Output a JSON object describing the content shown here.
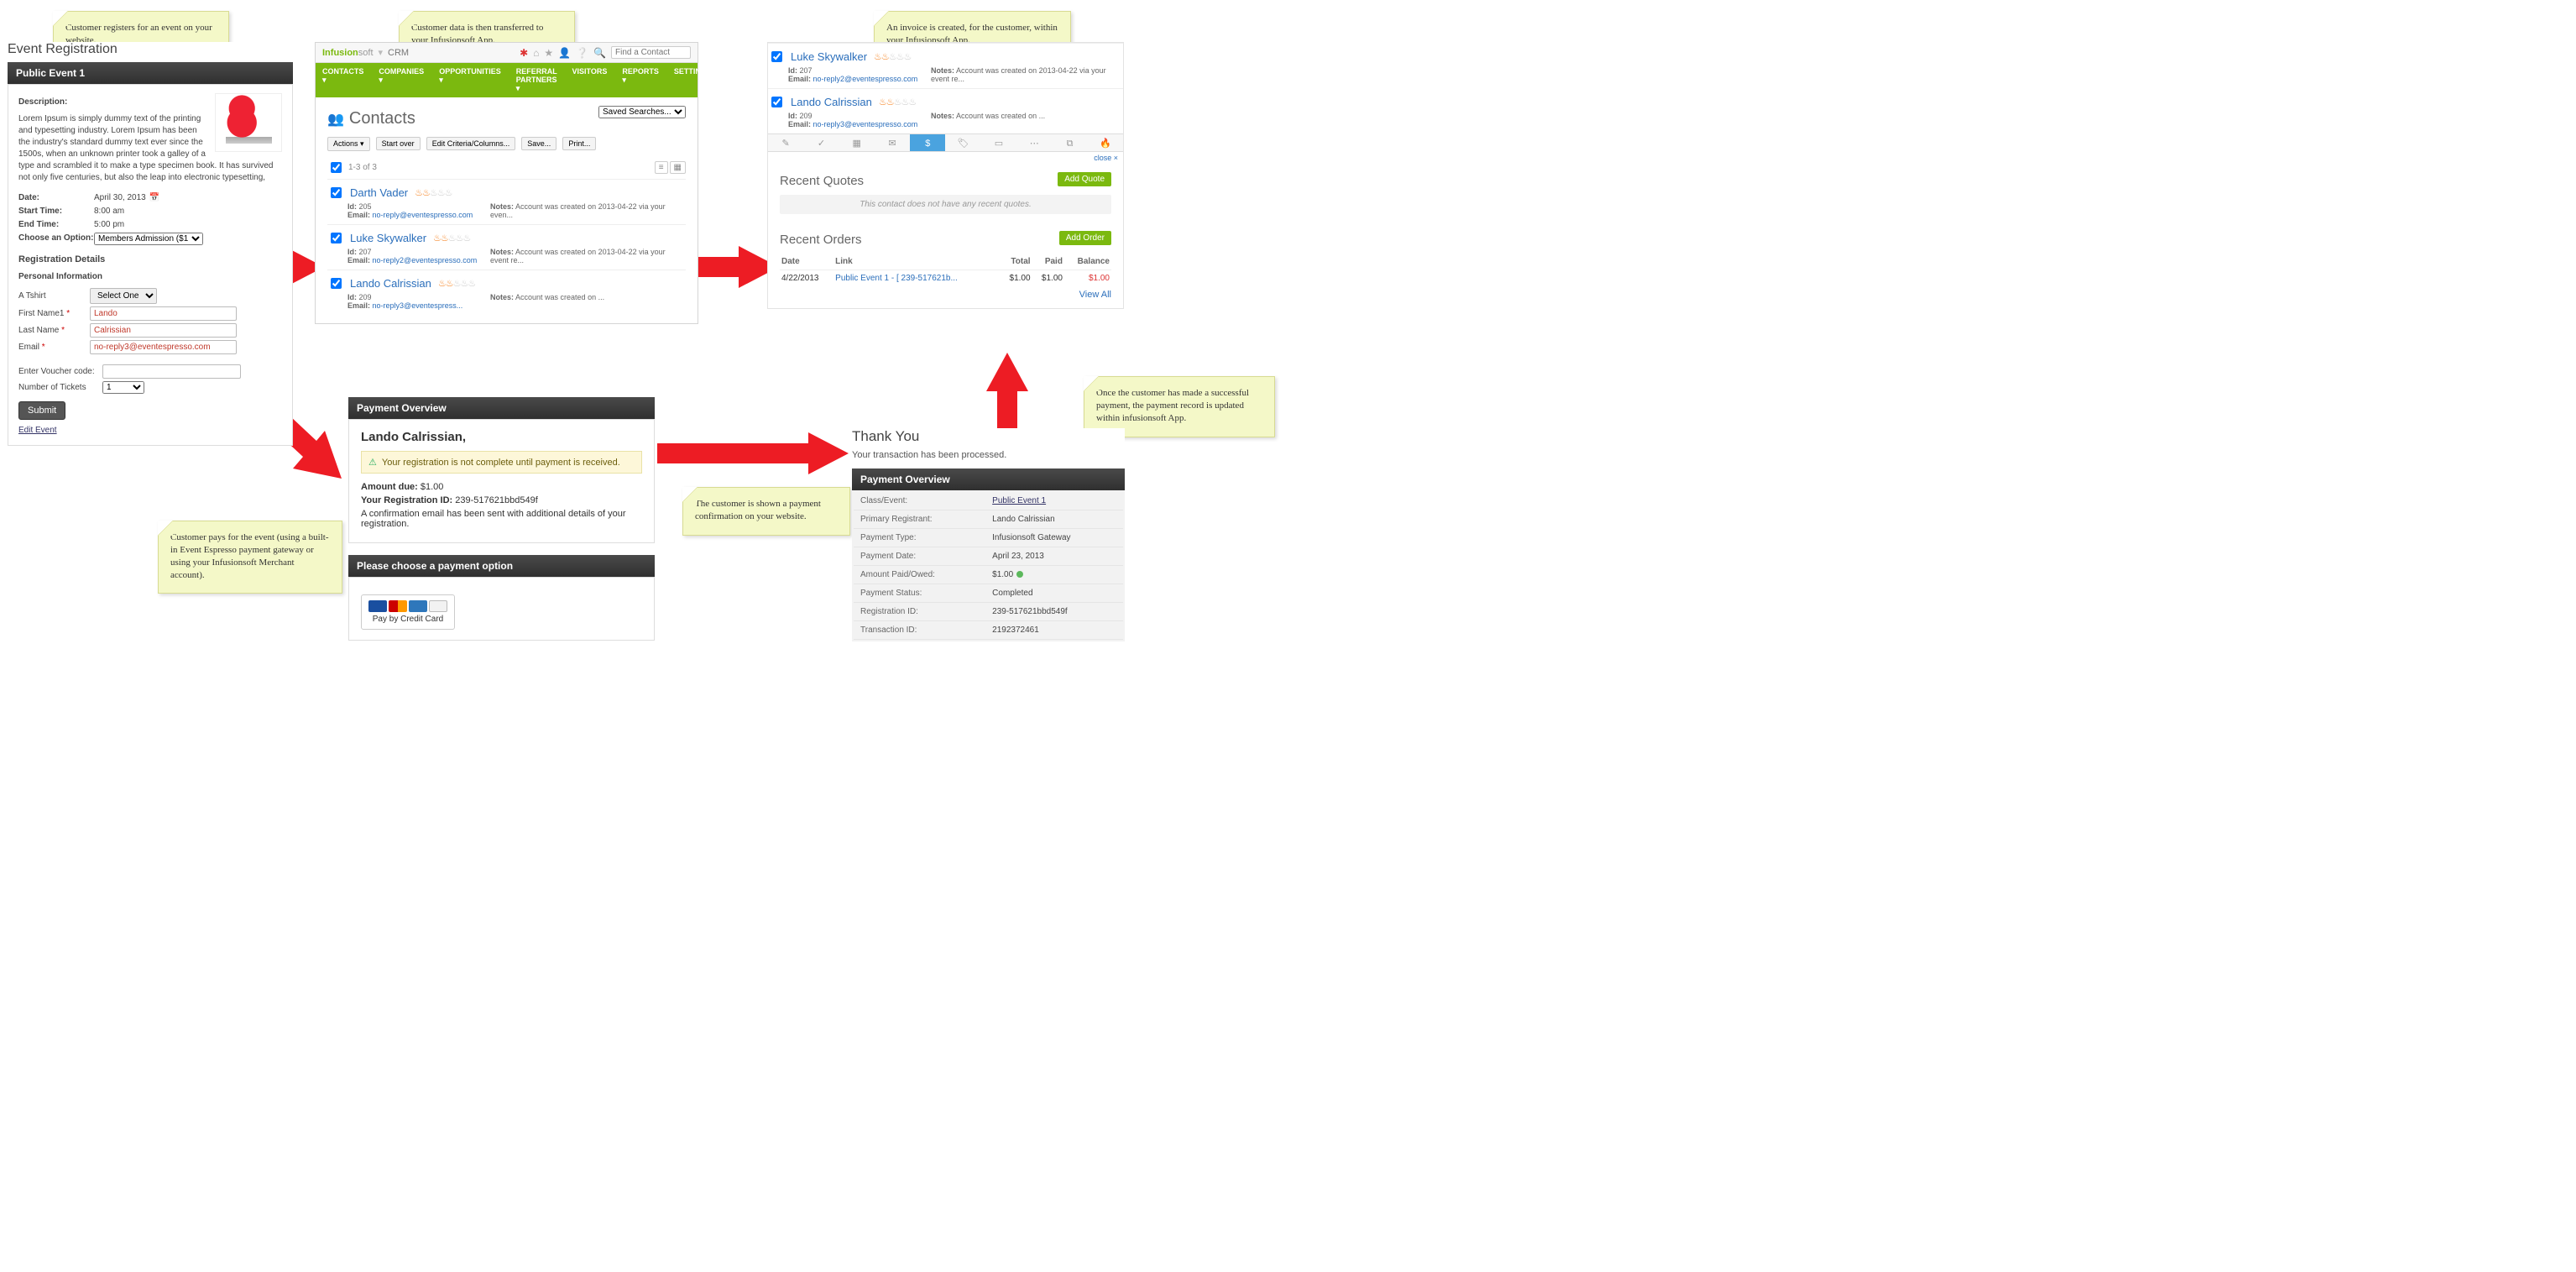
{
  "stickies": {
    "s1": "Customer registers for an event on your website.",
    "s2": "Customer data is then transferred to your Infusionsoft  App.",
    "s3": "An invoice is created, for the customer, within your Infusionsoft App.",
    "s4": "Customer pays for the event (using a built-in Event Espresso payment gateway or using your Infusionsoft Merchant account).",
    "s5": "The customer is shown a payment confirmation on your website.",
    "s6": "Once the customer has made a successful payment, the  payment record is updated within infusionsoft App."
  },
  "ev": {
    "page_title": "Event Registration",
    "event_title": "Public Event 1",
    "desc_label": "Description:",
    "desc": "Lorem Ipsum is simply dummy text of the printing and typesetting industry. Lorem Ipsum has been the industry's standard dummy text ever since the 1500s, when an unknown printer took a galley of a type and scrambled it to make a type specimen book. It has survived not only five centuries, but also the leap into electronic typesetting,",
    "date_k": "Date:",
    "date_v": "April 30, 2013",
    "start_k": "Start Time:",
    "start_v": "8:00 am",
    "end_k": "End Time:",
    "end_v": "5:00 pm",
    "opt_k": "Choose an Option:",
    "opt_v": "Members Admission ($1",
    "regdet": "Registration Details",
    "pinfo": "Personal Information",
    "tshirt_l": "A Tshirt",
    "tshirt_v": "Select One",
    "fn_l": "First Name1",
    "fn_v": "Lando",
    "ln_l": "Last Name",
    "ln_v": "Calrissian",
    "em_l": "Email",
    "em_v": "no-reply3@eventespresso.com",
    "vc_l": "Enter Voucher code:",
    "nt_l": "Number of Tickets",
    "nt_v": "1",
    "submit": "Submit",
    "edit": "Edit Event"
  },
  "crm": {
    "brand1": "Infusion",
    "brand2": "soft",
    "crm": "CRM",
    "nav": [
      "CONTACTS ▾",
      "COMPANIES ▾",
      "OPPORTUNITIES ▾",
      "REFERRAL PARTNERS ▾",
      "VISITORS",
      "REPORTS ▾",
      "SETTINGS"
    ],
    "search_ph": "Find a Contact",
    "contacts_title": "Contacts",
    "saved": "Saved Searches...",
    "btns": [
      "Actions ▾",
      "Start over",
      "Edit Criteria/Columns...",
      "Save...",
      "Print..."
    ],
    "range": "1-3 of 3",
    "list": [
      {
        "name": "Darth Vader",
        "flames": 2,
        "id": "205",
        "email": "no-reply@eventespresso.com",
        "notes": "Account was created on 2013-04-22 via your even..."
      },
      {
        "name": "Luke Skywalker",
        "flames": 2,
        "id": "207",
        "email": "no-reply2@eventespresso.com",
        "notes": "Account was created on 2013-04-22 via your event re..."
      },
      {
        "name": "Lando Calrissian",
        "flames": 2,
        "id": "209",
        "email": "no-reply3@eventespress...",
        "notes": "Account was created on ..."
      }
    ],
    "id_l": "Id:",
    "email_l": "Email:",
    "notes_l": "Notes:"
  },
  "inv": {
    "top_contacts": [
      {
        "name": "Luke Skywalker",
        "flames": 2,
        "id": "207",
        "email": "no-reply2@eventespresso.com",
        "notes": "Account was created on 2013-04-22 via your event re..."
      },
      {
        "name": "Lando Calrissian",
        "flames": 2,
        "id": "209",
        "email": "no-reply3@eventespresso.com",
        "notes": "Account was created on ..."
      }
    ],
    "close": "close ×",
    "rq": "Recent Quotes",
    "addq": "Add Quote",
    "noq": "This contact does not have any recent quotes.",
    "ro": "Recent Orders",
    "addo": "Add Order",
    "th": [
      "Date",
      "Link",
      "Total",
      "Paid",
      "Balance"
    ],
    "row": {
      "date": "4/22/2013",
      "link": "Public Event 1 - [ 239-517621b...",
      "total": "$1.00",
      "paid": "$1.00",
      "bal": "$1.00"
    },
    "viewall": "View All"
  },
  "pay": {
    "title": "Payment Overview",
    "name": "Lando Calrissian,",
    "warn": "Your registration is not complete until payment is received.",
    "amt_l": "Amount due:",
    "amt_v": "$1.00",
    "reg_l": "Your Registration ID:",
    "reg_v": "239-517621bbd549f",
    "conf": "A confirmation email has been sent with additional details of your registration.",
    "opt_title": "Please choose a payment option",
    "cc_label": "Pay by Credit Card"
  },
  "ty": {
    "h": "Thank You",
    "s": "Your transaction has been processed.",
    "title": "Payment Overview",
    "rows": [
      [
        "Class/Event:",
        "Public Event 1",
        true
      ],
      [
        "Primary Registrant:",
        "Lando Calrissian",
        false
      ],
      [
        "Payment Type:",
        "Infusionsoft Gateway",
        false
      ],
      [
        "Payment Date:",
        "April 23, 2013",
        false
      ],
      [
        "Amount Paid/Owed:",
        "$1.00",
        false,
        true
      ],
      [
        "Payment Status:",
        "Completed",
        false
      ],
      [
        "Registration ID:",
        "239-517621bbd549f",
        false
      ],
      [
        "Transaction ID:",
        "2192372461",
        false
      ]
    ]
  }
}
